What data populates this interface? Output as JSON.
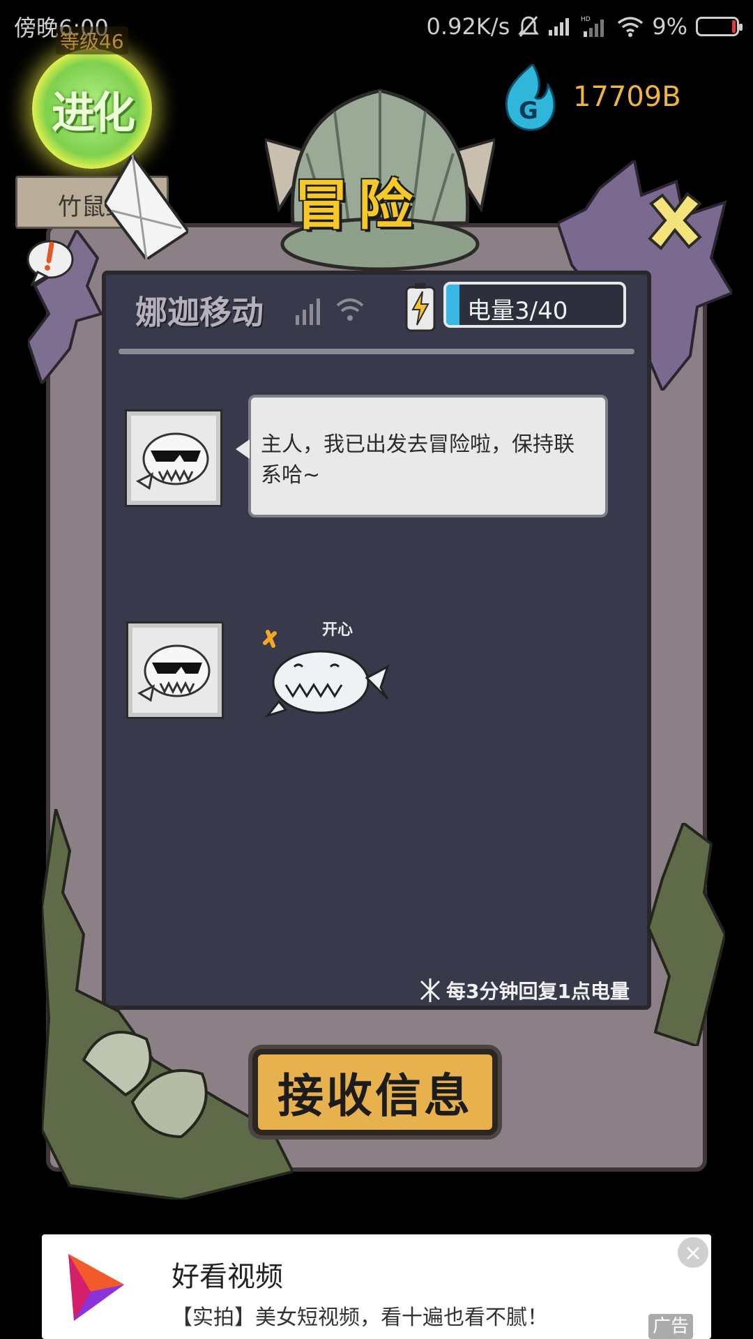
{
  "status_bar": {
    "time": "傍晚6:00",
    "network_speed": "0.92K/s",
    "battery_percent": "9%",
    "icons": [
      "mute-icon",
      "signal-icon",
      "hd-signal-icon",
      "wifi-icon",
      "battery-icon"
    ]
  },
  "player": {
    "level": "等级46",
    "evolve_label": "进化",
    "pet_name": "竹鼠鲸"
  },
  "currency": {
    "value": "17709B",
    "icon": "blue-flame-icon"
  },
  "title": "冒险",
  "phone_header": {
    "carrier": "娜迦移动",
    "energy_label": "电量3/40",
    "energy_fraction": 0.075
  },
  "chat": {
    "message": "主人，我已出发去冒险啦，保持联系哈~",
    "sticker_text": "开心"
  },
  "regen_note": "每3分钟回复1点电量",
  "receive_button": "接收信息",
  "ad": {
    "title": "好看视频",
    "description": "【实拍】美女短视频，看十遍也看不腻！",
    "tag": "广告",
    "close": "×"
  },
  "colors": {
    "accent_gold": "#f0b53c",
    "title_yellow": "#f7c928",
    "energy_blue": "#38b6e6",
    "button_orange": "#e7b14e"
  }
}
